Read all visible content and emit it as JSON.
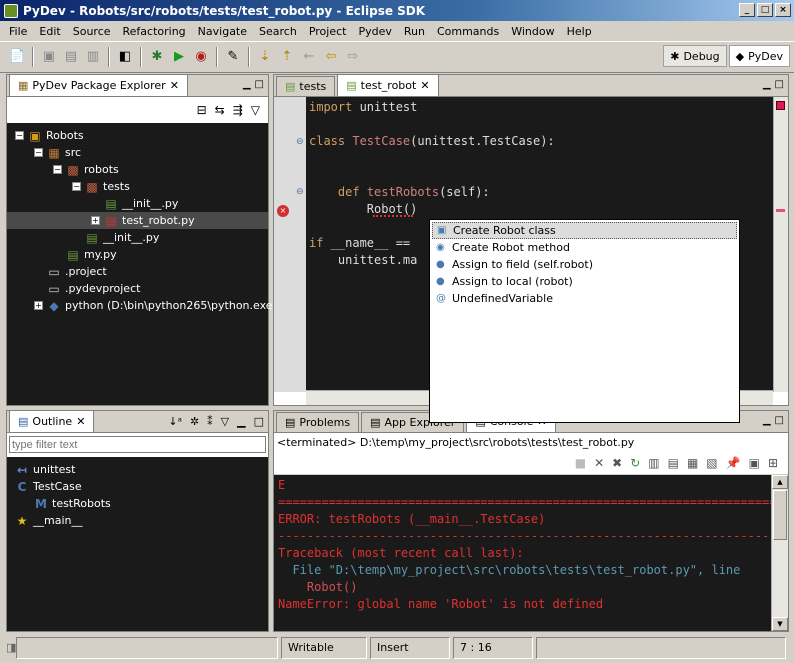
{
  "window": {
    "title": "PyDev - Robots/src/robots/tests/test_robot.py - Eclipse SDK"
  },
  "menu": [
    "File",
    "Edit",
    "Source",
    "Refactoring",
    "Navigate",
    "Search",
    "Project",
    "Pydev",
    "Run",
    "Commands",
    "Window",
    "Help"
  ],
  "perspectives": [
    {
      "label": "Debug",
      "active": false
    },
    {
      "label": "PyDev",
      "active": true
    }
  ],
  "package_explorer": {
    "title": "PyDev Package Explorer",
    "items": [
      {
        "label": "Robots",
        "indent": 0,
        "exp": "-",
        "icon": "project-icon"
      },
      {
        "label": "src",
        "indent": 1,
        "exp": "-",
        "icon": "source-folder-icon"
      },
      {
        "label": "robots",
        "indent": 2,
        "exp": "-",
        "icon": "package-icon"
      },
      {
        "label": "tests",
        "indent": 3,
        "exp": "-",
        "icon": "package-icon"
      },
      {
        "label": "__init__.py",
        "indent": 4,
        "exp": "",
        "icon": "python-file-icon"
      },
      {
        "label": "test_robot.py",
        "indent": 4,
        "exp": "+",
        "icon": "python-file-error-icon",
        "selected": true
      },
      {
        "label": "__init__.py",
        "indent": 3,
        "exp": "",
        "icon": "python-file-icon"
      },
      {
        "label": "my.py",
        "indent": 2,
        "exp": "",
        "icon": "python-file-icon"
      },
      {
        "label": ".project",
        "indent": 1,
        "exp": "",
        "icon": "file-icon"
      },
      {
        "label": ".pydevproject",
        "indent": 1,
        "exp": "",
        "icon": "file-icon"
      },
      {
        "label": "python  (D:\\bin\\python265\\python.exe)",
        "indent": 1,
        "exp": "+",
        "icon": "python-interpreter-icon"
      }
    ]
  },
  "outline": {
    "title": "Outline",
    "filter_placeholder": "type filter text",
    "items": [
      {
        "label": "unittest",
        "indent": 0,
        "icon": "import-icon"
      },
      {
        "label": "TestCase",
        "indent": 0,
        "icon": "class-icon"
      },
      {
        "label": "testRobots",
        "indent": 1,
        "icon": "method-icon"
      },
      {
        "label": "__main__",
        "indent": 0,
        "icon": "main-icon"
      }
    ]
  },
  "editor": {
    "tabs": [
      {
        "label": "tests",
        "active": false
      },
      {
        "label": "test_robot",
        "active": true
      }
    ],
    "lines": [
      {
        "parts": [
          [
            "kw",
            "import"
          ],
          [
            "t",
            " unittest"
          ]
        ]
      },
      {
        "parts": []
      },
      {
        "parts": [
          [
            "kw",
            "class"
          ],
          [
            "t",
            " "
          ],
          [
            "fn",
            "TestCase"
          ],
          [
            "t",
            "(unittest.TestCase):"
          ]
        ]
      },
      {
        "parts": []
      },
      {
        "parts": []
      },
      {
        "parts": [
          [
            "t",
            "    "
          ],
          [
            "kw",
            "def"
          ],
          [
            "t",
            " "
          ],
          [
            "fn",
            "testRobots"
          ],
          [
            "t",
            "(self):"
          ]
        ]
      },
      {
        "parts": [
          [
            "t",
            "        Robot()"
          ]
        ]
      },
      {
        "parts": []
      },
      {
        "parts": [
          [
            "kw",
            "if"
          ],
          [
            "t",
            " __name__ == "
          ]
        ]
      },
      {
        "parts": [
          [
            "t",
            "    unittest.ma"
          ]
        ]
      }
    ]
  },
  "quickfix": {
    "items": [
      {
        "label": "Create Robot class",
        "icon": "create-class-icon"
      },
      {
        "label": "Create Robot method",
        "icon": "create-method-icon"
      },
      {
        "label": "Assign to field (self.robot)",
        "icon": "assign-field-icon"
      },
      {
        "label": "Assign to local (robot)",
        "icon": "assign-local-icon"
      },
      {
        "label": "UndefinedVariable",
        "icon": "annotation-icon"
      }
    ]
  },
  "console": {
    "tabs": [
      {
        "label": "Problems"
      },
      {
        "label": "App Explorer"
      },
      {
        "label": "Console"
      }
    ],
    "header": "<terminated> D:\\temp\\my_project\\src\\robots\\tests\\test_robot.py",
    "lines": [
      "E",
      "======================================================================",
      "ERROR: testRobots (__main__.TestCase)",
      "----------------------------------------------------------------------",
      "Traceback (most recent call last):",
      "  File \"D:\\temp\\my_project\\src\\robots\\tests\\test_robot.py\", line",
      "    Robot()",
      "NameError: global name 'Robot' is not defined"
    ]
  },
  "status": {
    "writable": "Writable",
    "mode": "Insert",
    "position": "7 : 16"
  }
}
